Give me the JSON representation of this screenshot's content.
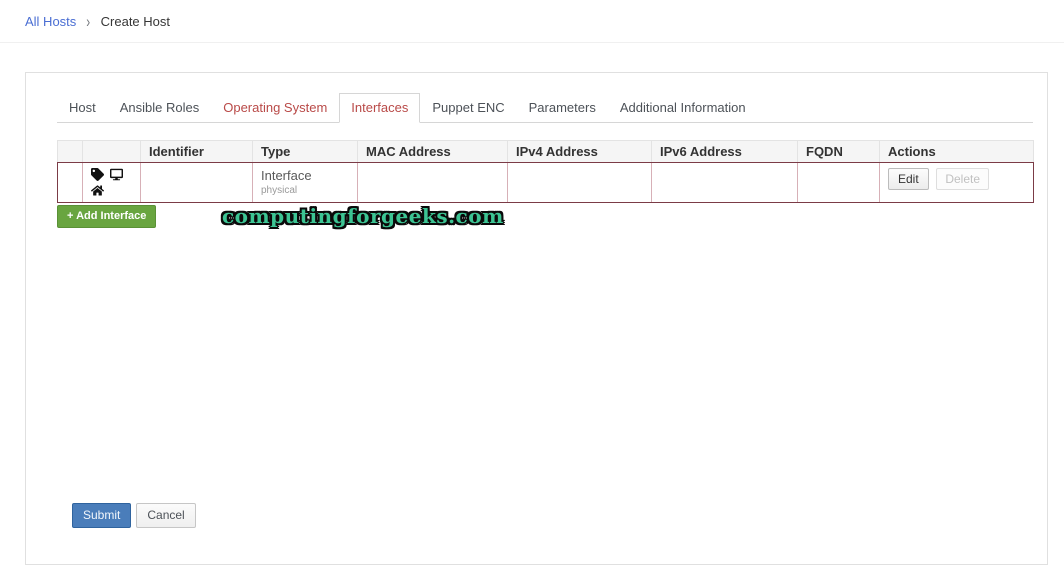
{
  "breadcrumb": {
    "link": "All Hosts",
    "separator": "›",
    "current": "Create Host"
  },
  "tabs": [
    {
      "label": "Host",
      "state": "normal"
    },
    {
      "label": "Ansible Roles",
      "state": "normal"
    },
    {
      "label": "Operating System",
      "state": "error"
    },
    {
      "label": "Interfaces",
      "state": "error-active"
    },
    {
      "label": "Puppet ENC",
      "state": "normal"
    },
    {
      "label": "Parameters",
      "state": "normal"
    },
    {
      "label": "Additional Information",
      "state": "normal"
    }
  ],
  "interfaces_table": {
    "columns": [
      "",
      "",
      "Identifier",
      "Type",
      "MAC Address",
      "IPv4 Address",
      "IPv6 Address",
      "FQDN",
      "Actions"
    ],
    "rows": [
      {
        "flags": [
          "tag-icon",
          "desktop-icon",
          "home-icon"
        ],
        "identifier": "",
        "type": "Interface",
        "type_detail": "physical",
        "mac_address": "",
        "ipv4_address": "",
        "ipv6_address": "",
        "fqdn": "",
        "actions": {
          "edit": "Edit",
          "delete": "Delete",
          "delete_disabled": true
        }
      }
    ]
  },
  "buttons": {
    "add_interface": "+ Add Interface",
    "submit": "Submit",
    "cancel": "Cancel"
  },
  "watermark": "computingforgeeks.com",
  "colors": {
    "link_blue": "#4a6ed3",
    "tab_error_red": "#b94a48",
    "row_error_border": "#7b3b46",
    "add_button_green": "#69a540",
    "submit_blue": "#4a7dba",
    "watermark_teal": "#3cc493",
    "header_bg": "#f5f5f5"
  }
}
